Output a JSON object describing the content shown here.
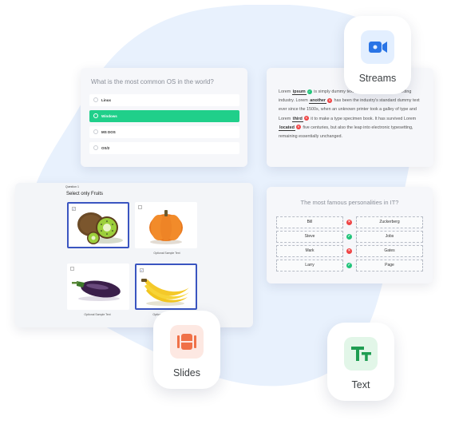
{
  "quiz": {
    "question": "What is the most common OS in the world?",
    "options": [
      {
        "label": "Linux",
        "selected": false
      },
      {
        "label": "Windows",
        "selected": true
      },
      {
        "label": "MS DOS",
        "selected": false
      },
      {
        "label": "OS/2",
        "selected": false
      }
    ]
  },
  "text_card": {
    "segments": [
      {
        "text": "Lorem "
      },
      {
        "text": "ipsum",
        "keyword": true,
        "status": "correct"
      },
      {
        "text": " is simply dummy text of the printing and typesetting industry. Lorem "
      },
      {
        "text": "another",
        "keyword": true,
        "status": "wrong"
      },
      {
        "text": " has been the industry's standard dummy text ever since the 1500s, when an unknown printer took a galley of type and Lorem "
      },
      {
        "text": "third",
        "keyword": true,
        "status": "wrong"
      },
      {
        "text": " it to make a type specimen book. It has survived Lorem "
      },
      {
        "text": "located",
        "keyword": true,
        "status": "wrong"
      },
      {
        "text": " five centuries, but also the leap into electronic typesetting, remaining essentially unchanged."
      }
    ]
  },
  "fruits": {
    "question_label": "Question 1",
    "title": "Select only Fruits",
    "items": [
      {
        "fruit": "kiwi",
        "checked": true,
        "caption": ""
      },
      {
        "fruit": "pumpkin",
        "checked": false,
        "caption": "Optional Sample Text"
      },
      {
        "fruit": "eggplant",
        "checked": false,
        "caption": "Optional Sample Text"
      },
      {
        "fruit": "banana",
        "checked": true,
        "caption": "Optional Sample Text"
      }
    ]
  },
  "match": {
    "question": "The most famous personalities in IT?",
    "rows": [
      {
        "left": "Bill",
        "right": "Zuckerberg",
        "status": "wrong"
      },
      {
        "left": "Steve",
        "right": "Jobs",
        "status": "correct"
      },
      {
        "left": "Mark",
        "right": "Gates",
        "status": "wrong"
      },
      {
        "left": "Larry",
        "right": "Page",
        "status": "correct"
      }
    ]
  },
  "apps": {
    "streams": {
      "label": "Streams",
      "icon": "video-camera-icon",
      "icon_bg": "#e3efff",
      "icon_color": "#2a75e6"
    },
    "slides": {
      "label": "Slides",
      "icon": "slides-icon",
      "icon_bg": "#fde8e2",
      "icon_color": "#f07148"
    },
    "text": {
      "label": "Text",
      "icon": "text-size-icon",
      "icon_bg": "#e2f6e8",
      "icon_color": "#1f9d52"
    }
  },
  "colors": {
    "background_blob": "#e8f1fd",
    "selected_option": "#20cf8a",
    "correct": "#22c47a",
    "wrong": "#ef4444",
    "selection_border": "#3a55c0"
  }
}
